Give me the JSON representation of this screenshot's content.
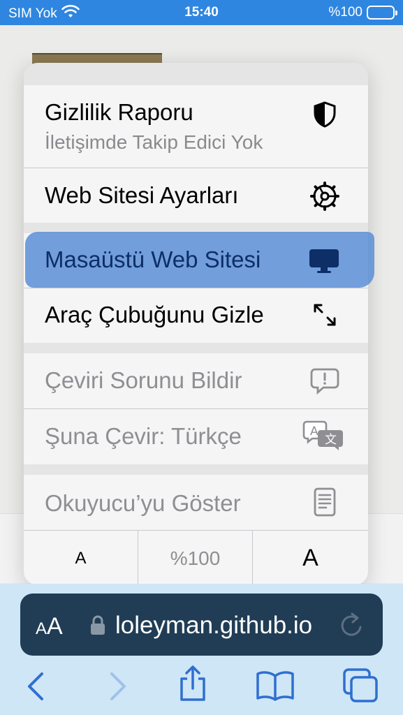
{
  "status": {
    "carrier": "SIM Yok",
    "time": "15:40",
    "battery": "%100"
  },
  "menu": {
    "privacy_report": {
      "label": "Gizlilik Raporu",
      "sublabel": "İletişimde Takip Edici Yok",
      "icon": "shield-icon"
    },
    "website_settings": {
      "label": "Web Sitesi Ayarları",
      "icon": "gear-icon"
    },
    "desktop_website": {
      "label": "Masaüstü Web Sitesi",
      "icon": "desktop-icon"
    },
    "hide_toolbar": {
      "label": "Araç Çubuğunu Gizle",
      "icon": "expand-arrows-icon"
    },
    "report_translation": {
      "label": "Çeviri Sorunu Bildir",
      "icon": "report-bubble-icon"
    },
    "translate_to": {
      "label": "Şuna Çevir: Türkçe",
      "icon": "translate-icon"
    },
    "show_reader": {
      "label": "Okuyucu’yu Göster",
      "icon": "reader-icon"
    },
    "font_size": {
      "decrease": "A",
      "zoom": "%100",
      "increase": "A"
    }
  },
  "address_bar": {
    "aa_small": "A",
    "aa_large": "A",
    "url": "loleyman.github.io"
  },
  "colors": {
    "status_bar": "#2f86e0",
    "highlight": "#5b8ed6",
    "address_bar": "#213d55",
    "toolbar": "#cfe6f7",
    "icon_blue": "#2f6fd0"
  }
}
